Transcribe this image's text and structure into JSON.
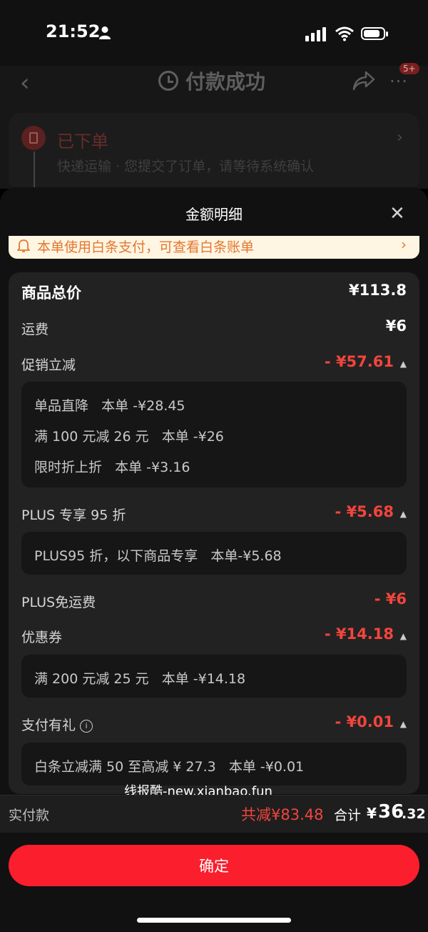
{
  "status_bar": {
    "time": "21:52"
  },
  "nav": {
    "title": "付款成功",
    "badge": "5+"
  },
  "order": {
    "status": "已下单",
    "description": "快递运输 · 您提交了订单，请等待系统确认"
  },
  "sheet": {
    "title": "金额明细",
    "notice": "本单使用白条支付，可查看白条账单",
    "rows": {
      "total": {
        "label": "商品总价",
        "value": "¥113.8"
      },
      "shipping": {
        "label": "运费",
        "value": "¥6"
      },
      "promo": {
        "label": "促销立减",
        "value": "- ¥57.61",
        "details": [
          "单品直降   本单 -¥28.45",
          "满 100 元减 26 元   本单 -¥26",
          "限时折上折   本单 -¥3.16"
        ]
      },
      "plus": {
        "label": "PLUS 专享 95 折",
        "value": "- ¥5.68",
        "details": [
          "PLUS95 折，以下商品专享   本单-¥5.68"
        ]
      },
      "plus_ship": {
        "label": "PLUS免运费",
        "value": "- ¥6"
      },
      "coupon": {
        "label": "优惠券",
        "value": "- ¥14.18",
        "details": [
          "满 200 元减 25 元   本单 -¥14.18"
        ]
      },
      "gift": {
        "label": "支付有礼",
        "value": "- ¥0.01",
        "details": [
          "白条立减满 50 至高减 ¥ 27.3   本单 -¥0.01"
        ]
      }
    }
  },
  "watermark": "线报酷-new.xianbao.fun",
  "footer": {
    "paid_label": "实付款",
    "saved": "共减¥83.48",
    "total_label": "合计",
    "currency": "¥",
    "total_int": "36",
    "total_dec": ".32",
    "confirm": "确定"
  },
  "colors": {
    "accent": "#fb1e2d",
    "discount": "#f2453d",
    "notice_text": "#e2782f"
  },
  "icons": [
    "person-icon",
    "signal-icon",
    "wifi-icon",
    "battery-icon",
    "back-icon",
    "clock-icon",
    "share-icon",
    "more-icon",
    "order-icon",
    "chevron-right-icon",
    "close-icon",
    "bell-icon",
    "caret-up-icon",
    "info-icon"
  ]
}
